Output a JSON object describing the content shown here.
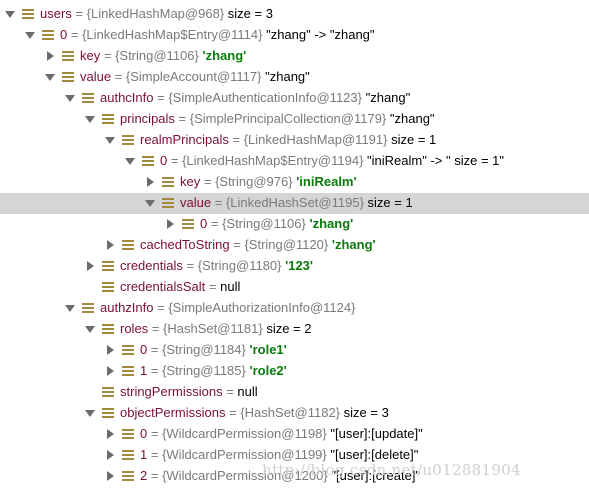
{
  "rows": [
    {
      "name": "users",
      "type": "{LinkedHashMap@968}",
      "desc": "",
      "size": "size = 3",
      "str": "",
      "arrow": "expanded",
      "selected": false
    },
    {
      "name": "0",
      "type": "{LinkedHashMap$Entry@1114}",
      "desc": "\"zhang\" -> \"zhang\"",
      "size": "",
      "str": "",
      "arrow": "expanded",
      "selected": false
    },
    {
      "name": "key",
      "type": "{String@1106}",
      "desc": "",
      "size": "",
      "str": "'zhang'",
      "arrow": "collapsed",
      "selected": false
    },
    {
      "name": "value",
      "type": "{SimpleAccount@1117}",
      "desc": "\"zhang\"",
      "size": "",
      "str": "",
      "arrow": "expanded",
      "selected": false
    },
    {
      "name": "authcInfo",
      "type": "{SimpleAuthenticationInfo@1123}",
      "desc": "\"zhang\"",
      "size": "",
      "str": "",
      "arrow": "expanded",
      "selected": false
    },
    {
      "name": "principals",
      "type": "{SimplePrincipalCollection@1179}",
      "desc": "\"zhang\"",
      "size": "",
      "str": "",
      "arrow": "expanded",
      "selected": false
    },
    {
      "name": "realmPrincipals",
      "type": "{LinkedHashMap@1191}",
      "desc": "",
      "size": "size = 1",
      "str": "",
      "arrow": "expanded",
      "selected": false
    },
    {
      "name": "0",
      "type": "{LinkedHashMap$Entry@1194}",
      "desc": "\"iniRealm\" -> \" size = 1\"",
      "size": "",
      "str": "",
      "arrow": "expanded",
      "selected": false
    },
    {
      "name": "key",
      "type": "{String@976}",
      "desc": "",
      "size": "",
      "str": "'iniRealm'",
      "arrow": "collapsed",
      "selected": false
    },
    {
      "name": "value",
      "type": "{LinkedHashSet@1195}",
      "desc": "",
      "size": "size = 1",
      "str": "",
      "arrow": "expanded",
      "selected": true
    },
    {
      "name": "0",
      "type": "{String@1106}",
      "desc": "",
      "size": "",
      "str": "'zhang'",
      "arrow": "collapsed",
      "selected": false
    },
    {
      "name": "cachedToString",
      "type": "{String@1120}",
      "desc": "",
      "size": "",
      "str": "'zhang'",
      "arrow": "collapsed",
      "selected": false
    },
    {
      "name": "credentials",
      "type": "{String@1180}",
      "desc": "",
      "size": "",
      "str": "'123'",
      "arrow": "collapsed",
      "selected": false
    },
    {
      "name": "credentialsSalt",
      "type": "",
      "desc": "null",
      "size": "",
      "str": "",
      "arrow": "none",
      "selected": false
    },
    {
      "name": "authzInfo",
      "type": "{SimpleAuthorizationInfo@1124}",
      "desc": "",
      "size": "",
      "str": "",
      "arrow": "expanded",
      "selected": false
    },
    {
      "name": "roles",
      "type": "{HashSet@1181}",
      "desc": "",
      "size": "size = 2",
      "str": "",
      "arrow": "expanded",
      "selected": false
    },
    {
      "name": "0",
      "type": "{String@1184}",
      "desc": "",
      "size": "",
      "str": "'role1'",
      "arrow": "collapsed",
      "selected": false
    },
    {
      "name": "1",
      "type": "{String@1185}",
      "desc": "",
      "size": "",
      "str": "'role2'",
      "arrow": "collapsed",
      "selected": false
    },
    {
      "name": "stringPermissions",
      "type": "",
      "desc": "null",
      "size": "",
      "str": "",
      "arrow": "none",
      "selected": false
    },
    {
      "name": "objectPermissions",
      "type": "{HashSet@1182}",
      "desc": "",
      "size": "size = 3",
      "str": "",
      "arrow": "expanded",
      "selected": false
    },
    {
      "name": "0",
      "type": "{WildcardPermission@1198}",
      "desc": "\"[user]:[update]\"",
      "size": "",
      "str": "",
      "arrow": "collapsed",
      "selected": false
    },
    {
      "name": "1",
      "type": "{WildcardPermission@1199}",
      "desc": "\"[user]:[delete]\"",
      "size": "",
      "str": "",
      "arrow": "collapsed",
      "selected": false
    },
    {
      "name": "2",
      "type": "{WildcardPermission@1200}",
      "desc": "\"[user]:[create]\"",
      "size": "",
      "str": "",
      "arrow": "collapsed",
      "selected": false
    }
  ],
  "eq": "=",
  "watermark": "http://blog.csdn.net/u012881904",
  "colors": {
    "field_name": "#7a0f3a",
    "string_value": "#0a7a0a",
    "selection": "#d5d5d5",
    "icon": "#a08a3c"
  }
}
